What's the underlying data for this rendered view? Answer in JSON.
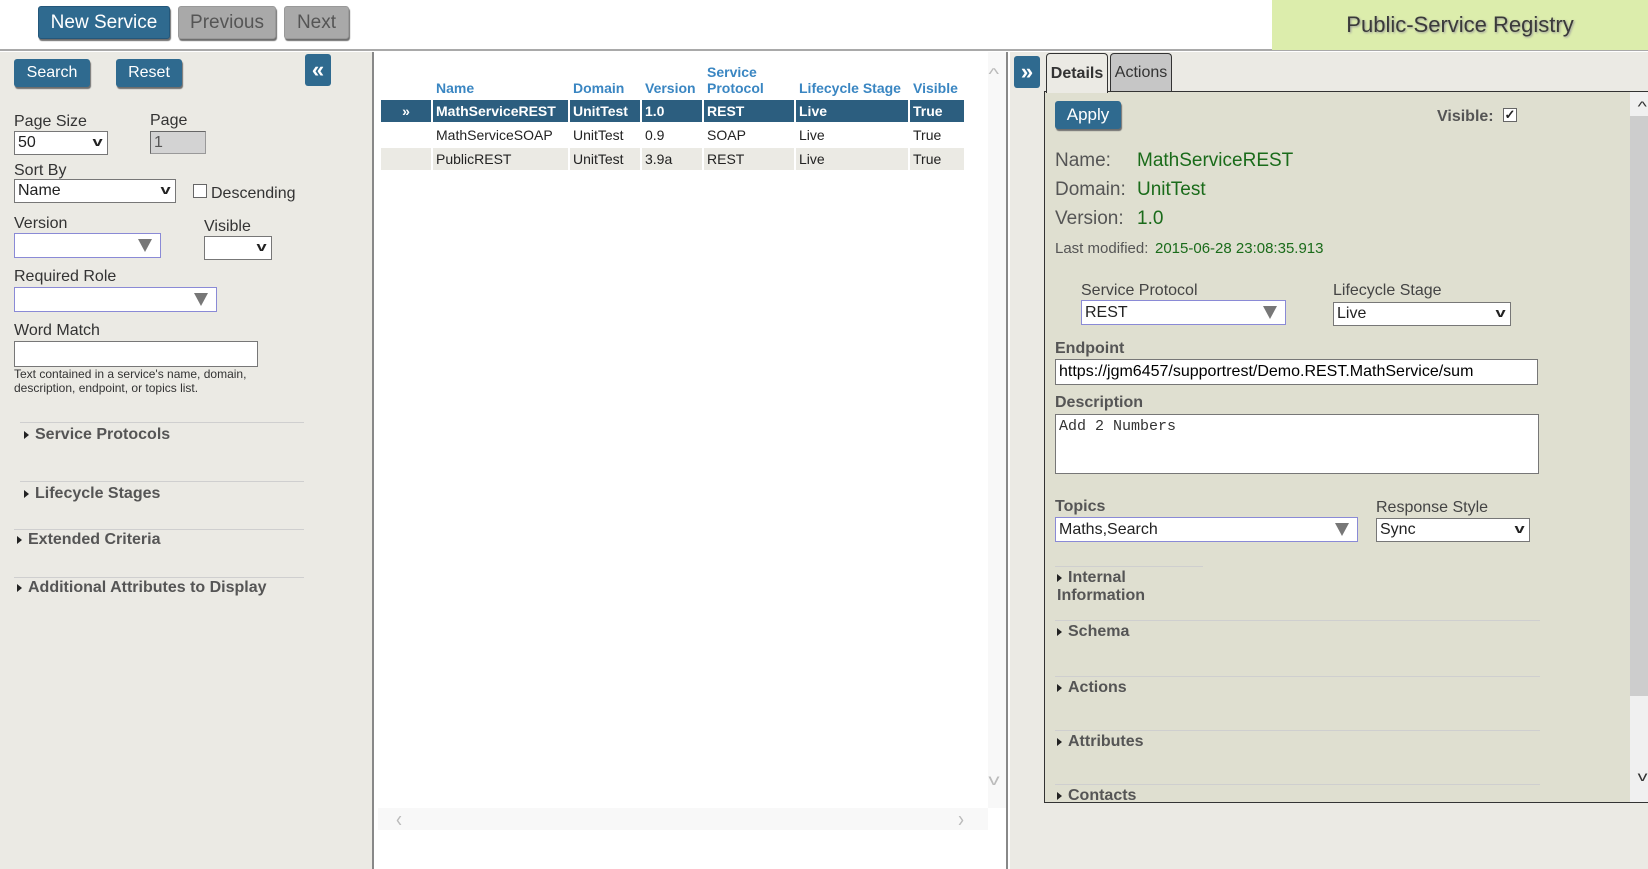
{
  "topbar": {
    "new_service": "New Service",
    "previous": "Previous",
    "next": "Next",
    "brand": "Public-Service Registry"
  },
  "search": {
    "search_button": "Search",
    "reset_button": "Reset",
    "collapse_icon": "«",
    "page_size_label": "Page Size",
    "page_size_value": "50",
    "page_label": "Page",
    "page_value": "1",
    "sort_by_label": "Sort By",
    "sort_by_value": "Name",
    "descending_label": "Descending",
    "descending_checked": false,
    "version_label": "Version",
    "version_value": "",
    "visible_label": "Visible",
    "visible_value": "",
    "required_role_label": "Required Role",
    "required_role_value": "",
    "word_match_label": "Word Match",
    "word_match_value": "",
    "word_match_hint": "Text contained in a service's name, domain, description, endpoint, or topics list.",
    "sections": [
      "Service Protocols",
      "Lifecycle Stages",
      "Extended Criteria",
      "Additional Attributes to Display"
    ]
  },
  "grid": {
    "selected_marker": "»",
    "columns": [
      "Name",
      "Domain",
      "Version",
      "Service Protocol",
      "Lifecycle Stage",
      "Visible"
    ],
    "rows": [
      {
        "name": "MathServiceREST",
        "domain": "UnitTest",
        "version": "1.0",
        "protocol": "REST",
        "stage": "Live",
        "visible": "True",
        "selected": true
      },
      {
        "name": "MathServiceSOAP",
        "domain": "UnitTest",
        "version": "0.9",
        "protocol": "SOAP",
        "stage": "Live",
        "visible": "True",
        "selected": false
      },
      {
        "name": "PublicREST",
        "domain": "UnitTest",
        "version": "3.9a",
        "protocol": "REST",
        "stage": "Live",
        "visible": "True",
        "selected": false
      }
    ]
  },
  "details": {
    "expand_icon": "»",
    "tabs": [
      "Details",
      "Actions"
    ],
    "active_tab": "Details",
    "apply_button": "Apply",
    "visible_label": "Visible:",
    "visible_checked": true,
    "name_label": "Name:",
    "name_value": "MathServiceREST",
    "domain_label": "Domain:",
    "domain_value": "UnitTest",
    "version_label": "Version:",
    "version_value": "1.0",
    "last_modified_label": "Last modified:",
    "last_modified_value": "2015-06-28 23:08:35.913",
    "protocol_label": "Service Protocol",
    "protocol_value": "REST",
    "stage_label": "Lifecycle Stage",
    "stage_value": "Live",
    "endpoint_label": "Endpoint",
    "endpoint_value": "https://jgm6457/supportrest/Demo.REST.MathService/sum",
    "description_label": "Description",
    "description_value": "Add 2 Numbers",
    "topics_label": "Topics",
    "topics_value": "Maths,Search",
    "response_style_label": "Response Style",
    "response_style_value": "Sync",
    "sections": [
      "Internal Information",
      "Schema",
      "Actions",
      "Attributes",
      "Contacts"
    ]
  },
  "colors": {
    "primary": "#2f6a8f",
    "selected_row": "#2c5e7f",
    "header_text": "#3a86c2",
    "brand_bg": "#dcedac",
    "value_green": "#1a6b1a"
  }
}
